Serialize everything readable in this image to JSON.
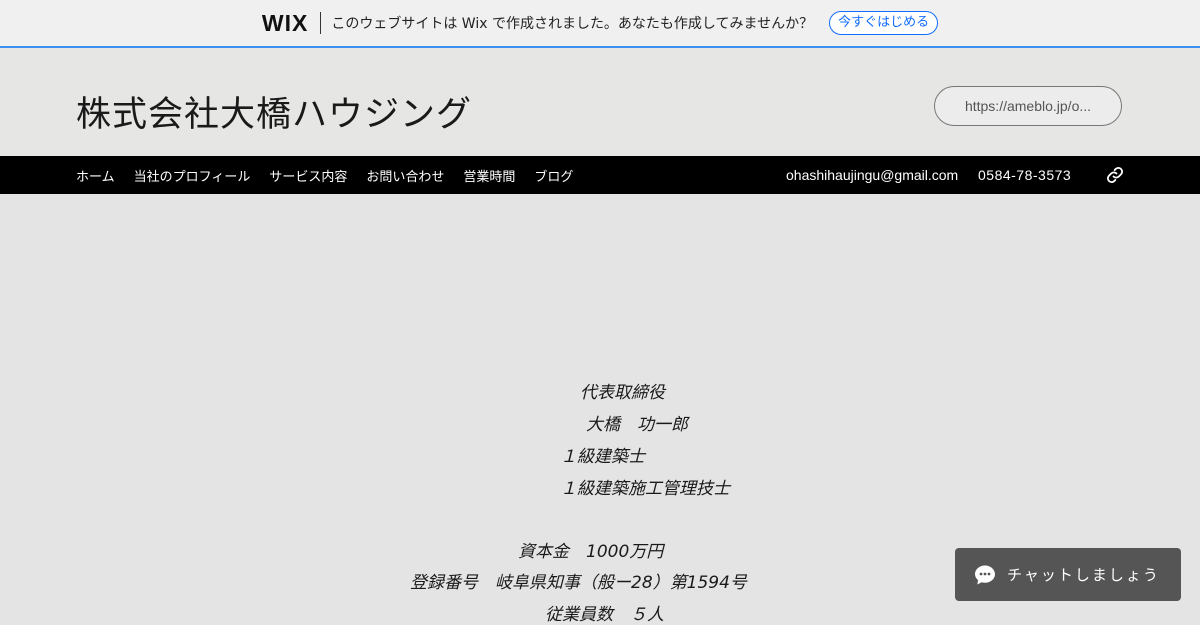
{
  "wix_banner": {
    "logo": "WIX",
    "message": "このウェブサイトは Wix で作成されました。あなたも作成してみませんか？",
    "cta": "今すぐはじめる"
  },
  "header": {
    "company_name": "株式会社大橋ハウジング",
    "blog_link": "https://ameblo.jp/o..."
  },
  "nav": {
    "items": [
      "ホーム",
      "当社のプロフィール",
      "サービス内容",
      "お問い合わせ",
      "営業時間",
      "ブログ"
    ],
    "email": "ohashihaujingu@gmail.com",
    "phone": "0584-78-3573",
    "link_icon": "link-icon"
  },
  "content": {
    "lines": [
      "代表取締役",
      "大橋　功一郎",
      "１級建築士",
      "１級建築施工管理技士",
      "資本金　1000万円",
      "登録番号　岐阜県知事（般ー28）第1594号",
      "従業員数　５人"
    ]
  },
  "chat": {
    "label": "チャットしましょう",
    "icon": "chat-bubble-icon"
  },
  "colors": {
    "page_bg": "#e4e4e4",
    "nav_bg": "#000000",
    "banner_accent": "#3a8ff0",
    "cta_blue": "#116dff",
    "chat_bg": "#555555"
  }
}
